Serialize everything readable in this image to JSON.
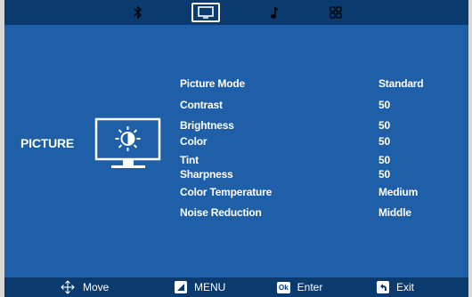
{
  "topbar": {
    "tabs": [
      {
        "icon": "bluetooth-icon",
        "active": false
      },
      {
        "icon": "monitor-icon",
        "active": true
      },
      {
        "icon": "music-note-icon",
        "active": false
      },
      {
        "icon": "apps-grid-icon",
        "active": false
      }
    ]
  },
  "category": {
    "label": "PICTURE",
    "icon": "monitor-brightness-icon"
  },
  "menu": {
    "items": [
      {
        "label": "Picture Mode",
        "value": "Standard"
      },
      {
        "label": "Contrast",
        "value": "50"
      },
      {
        "label": "Brightness",
        "value": "50"
      },
      {
        "label": "Color",
        "value": "50"
      },
      {
        "label": "Tint",
        "value": "50"
      },
      {
        "label": "Sharpness",
        "value": "50"
      },
      {
        "label": "Color Temperature",
        "value": "Medium"
      },
      {
        "label": "Noise Reduction",
        "value": "Middle"
      }
    ]
  },
  "bottombar": {
    "move": {
      "label": "Move",
      "icon": "four-way-arrow-icon"
    },
    "menu": {
      "label": "MENU",
      "icon": "menu-key-icon"
    },
    "enter": {
      "label": "Enter",
      "key": "Ok",
      "icon": "ok-key-icon"
    },
    "exit": {
      "label": "Exit",
      "icon": "back-arrow-icon"
    }
  },
  "colors": {
    "background": "#1f5fa8",
    "bars": "#0b3a6e",
    "text": "#ffffff"
  }
}
